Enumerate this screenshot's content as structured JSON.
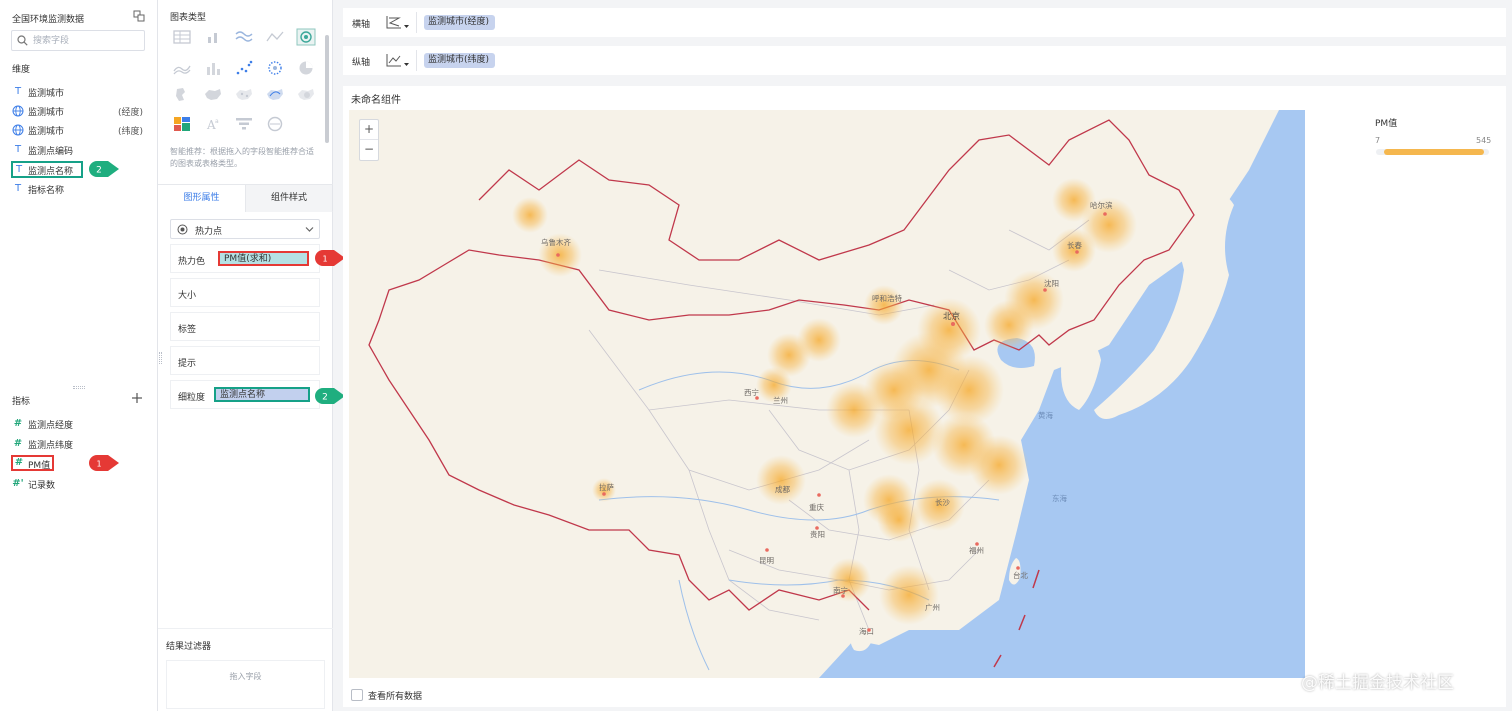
{
  "left_panel": {
    "dataset_title": "全国环境监测数据",
    "search": {
      "placeholder": "搜索字段",
      "value": ""
    },
    "dimensions_title": "维度",
    "dimensions": [
      {
        "type": "T",
        "label": "监测城市",
        "sub": ""
      },
      {
        "type": "globe",
        "label": "监测城市",
        "sub": "(经度)"
      },
      {
        "type": "globe",
        "label": "监测城市",
        "sub": "(纬度)"
      },
      {
        "type": "T",
        "label": "监测点编码",
        "sub": ""
      },
      {
        "type": "T",
        "label": "监测点名称",
        "sub": ""
      },
      {
        "type": "T",
        "label": "指标名称",
        "sub": ""
      }
    ],
    "measures_title": "指标",
    "measures": [
      {
        "type": "#",
        "label": "监测点经度"
      },
      {
        "type": "#",
        "label": "监测点纬度"
      },
      {
        "type": "#",
        "label": "PM值"
      },
      {
        "type": "#'",
        "label": "记录数"
      }
    ]
  },
  "callouts": [
    "1",
    "2"
  ],
  "config_panel": {
    "chart_type_title": "图表类型",
    "smart_tip": "智能推荐：根据拖入的字段智能推荐合适的图表或表格类型。",
    "tabs": [
      "图形属性",
      "组件样式"
    ],
    "active_tab": "图形属性",
    "chart_style": "热力点",
    "properties": {
      "heat_color": {
        "label": "热力色",
        "value": "PM值(求和)"
      },
      "size": {
        "label": "大小"
      },
      "tag": {
        "label": "标签"
      },
      "tooltip": {
        "label": "提示"
      },
      "granularity": {
        "label": "细粒度",
        "value": "监测点名称"
      }
    },
    "filter_title": "结果过滤器",
    "filter_placeholder": "拖入字段"
  },
  "axes": {
    "x": {
      "label": "横轴",
      "field": "监测城市(经度)"
    },
    "y": {
      "label": "纵轴",
      "field": "监测城市(纬度)"
    }
  },
  "component": {
    "title": "未命名组件",
    "zoom_in": "+",
    "zoom_out": "−",
    "legend": {
      "title": "PM值",
      "min": "7",
      "max": "545",
      "color": "#f5b74e"
    },
    "map_labels": {
      "urumqi": "乌鲁木齐",
      "harbin": "哈尔滨",
      "changchun": "长春",
      "shenyang": "沈阳",
      "hohhot": "呼和浩特",
      "beijing": "北京",
      "xining": "西宁",
      "lanzhou": "兰州",
      "yellow_sea": "黄海",
      "east_sea": "东海",
      "lhasa": "拉萨",
      "chengdu": "成都",
      "chongqing": "重庆",
      "changsha": "长沙",
      "guiyang": "贵阳",
      "fuzhou": "福州",
      "taipei": "台北",
      "kunming": "昆明",
      "nanning": "南宁",
      "guangzhou": "广州",
      "haikou": "海口"
    },
    "view_all": "查看所有数据"
  },
  "watermark": "@稀土掘金技术社区",
  "colors": {
    "accent_blue": "#3d7ee8",
    "highlight_red": "#e53935",
    "highlight_green": "#16a188",
    "heat": "#f5a623",
    "sea": "#a7c8f2",
    "land": "#f6f2e8",
    "border_line": "#c0384b"
  }
}
